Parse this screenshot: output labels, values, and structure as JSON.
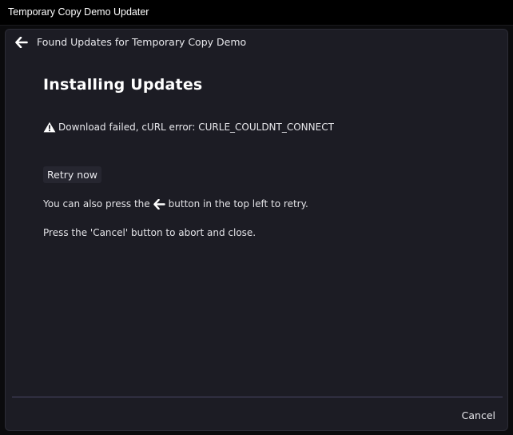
{
  "titlebar": {
    "title": "Temporary Copy Demo Updater"
  },
  "header": {
    "back_icon": "arrow-left-icon",
    "heading": "Found Updates for Temporary Copy Demo"
  },
  "main": {
    "title": "Installing Updates",
    "error": {
      "icon": "warning-icon",
      "message": "Download failed, cURL error: CURLE_COULDNT_CONNECT"
    },
    "retry_label": "Retry now",
    "hint_before_icon": "You can also press the",
    "hint_icon": "arrow-left-icon",
    "hint_after_icon": "button in the top left to retry.",
    "cancel_hint": "Press the 'Cancel' button to abort and close."
  },
  "footer": {
    "cancel_label": "Cancel"
  },
  "colors": {
    "background": "#1c1c24",
    "titlebar": "#000000",
    "divider": "#4a4766",
    "button": "#262630"
  }
}
